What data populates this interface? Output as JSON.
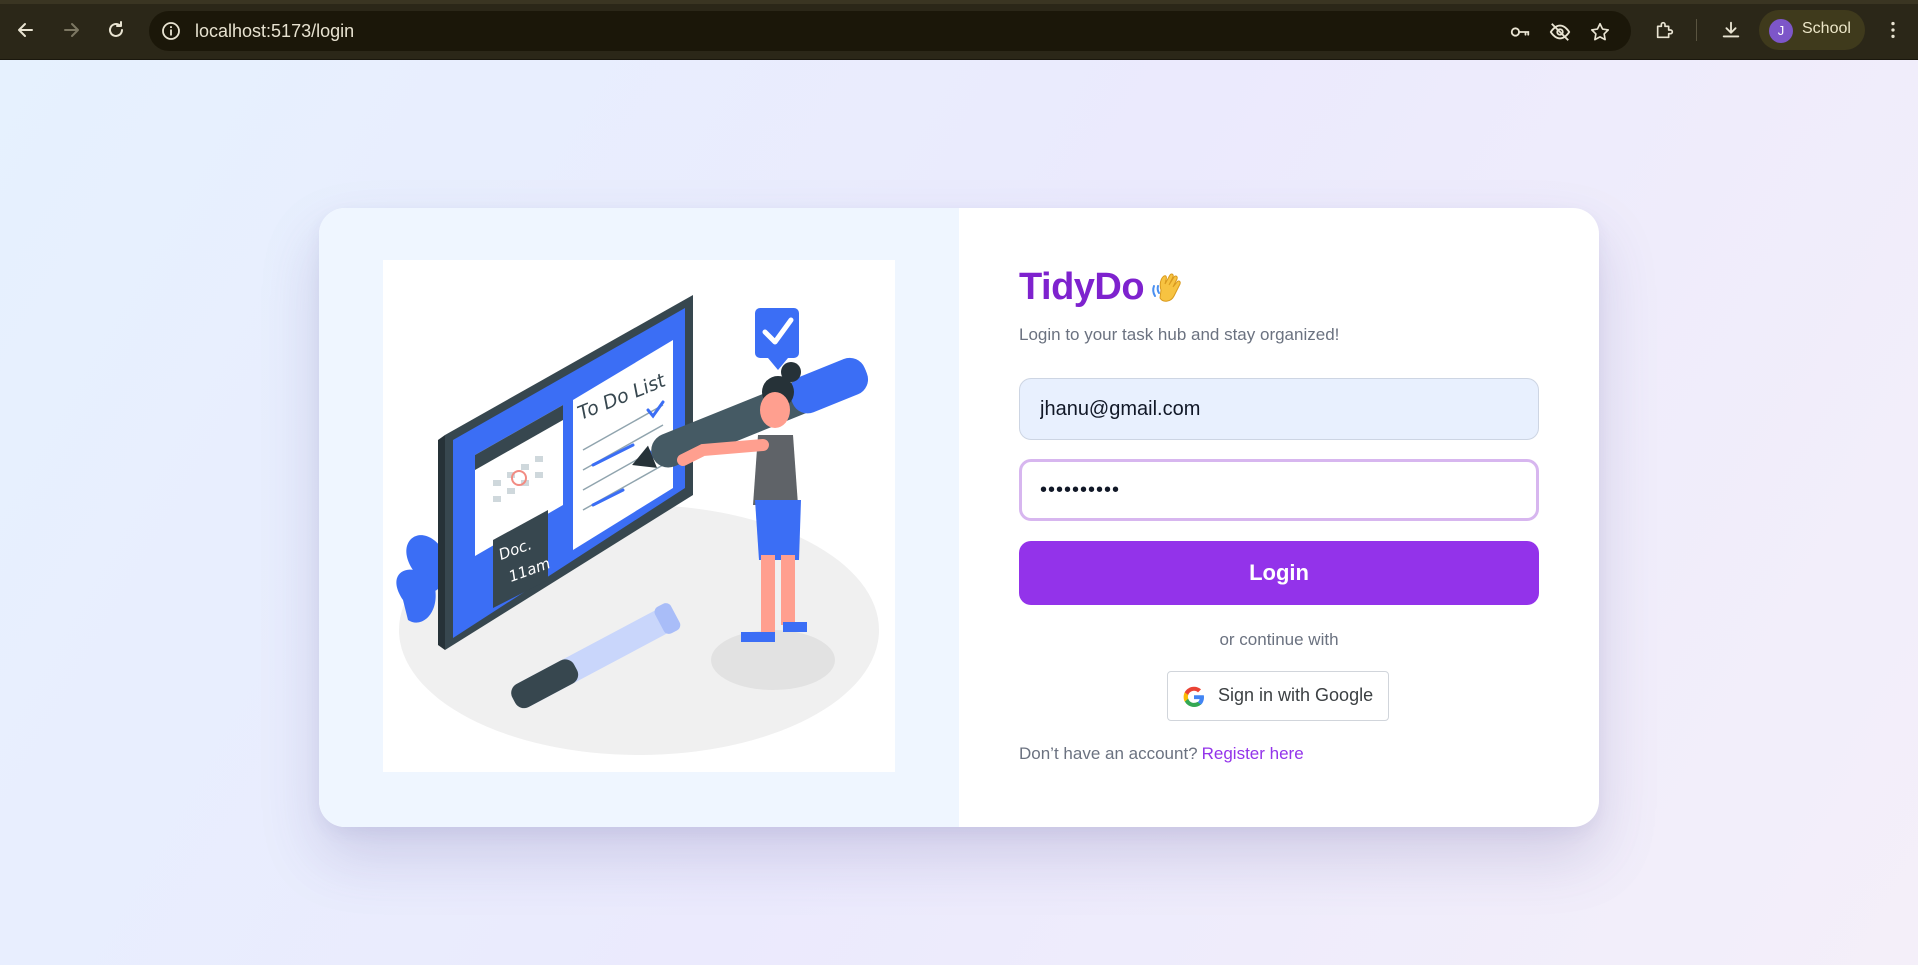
{
  "browser": {
    "url": "localhost:5173/login",
    "profile_initial": "J",
    "profile_name": "School",
    "profile_color": "#7d56c9"
  },
  "login": {
    "brand": "TidyDo",
    "brand_emoji": "waving-hand-icon",
    "subtitle": "Login to your task hub and stay organized!",
    "email_value": "jhanu@gmail.com",
    "password_masked": "••••••••••",
    "login_label": "Login",
    "or_text": "or continue with",
    "google_label": "Sign in with Google",
    "register_prompt": "Don’t have an account?",
    "register_link": "Register here"
  },
  "illustration": {
    "board_list_title": "To Do List",
    "note_line1": "Doc.",
    "note_line2": "11am"
  },
  "colors": {
    "brand": "#7e22ce",
    "button": "#9333ea",
    "illustration_blue": "#3b6ef5"
  }
}
